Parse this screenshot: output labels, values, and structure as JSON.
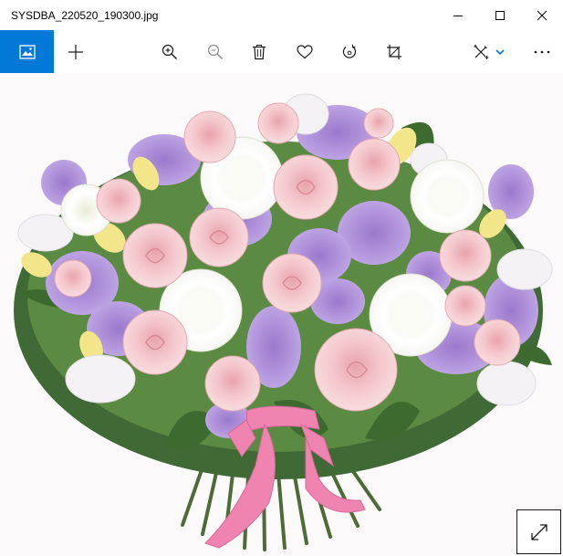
{
  "window": {
    "title": "SYSDBA_220520_190300.jpg",
    "controls": [
      "minimize-icon",
      "maximize-icon",
      "close-icon"
    ]
  },
  "toolbar": {
    "items": [
      {
        "name": "see-all-photos",
        "icon": "photo-gallery-icon",
        "active": true
      },
      {
        "name": "add-to",
        "icon": "plus-icon"
      },
      {
        "name": "zoom-in",
        "icon": "zoom-in-icon"
      },
      {
        "name": "zoom-out",
        "icon": "zoom-out-icon"
      },
      {
        "name": "delete",
        "icon": "trash-icon"
      },
      {
        "name": "favorite",
        "icon": "heart-icon"
      },
      {
        "name": "rotate",
        "icon": "rotate-icon"
      },
      {
        "name": "crop",
        "icon": "crop-icon"
      },
      {
        "name": "edit-and-create",
        "icon": "edit-create-icon"
      },
      {
        "name": "see-more",
        "icon": "more-ellipsis-icon"
      }
    ]
  },
  "viewer": {
    "image_subject": "flower-bouquet-photo",
    "fullscreen_icon": "expand-diagonal-icon"
  },
  "colors": {
    "accent": "#0078d7",
    "viewer_background": "#fbf9fa",
    "icon": "#1a1a1a",
    "disabled_icon": "#8a8a8a"
  }
}
